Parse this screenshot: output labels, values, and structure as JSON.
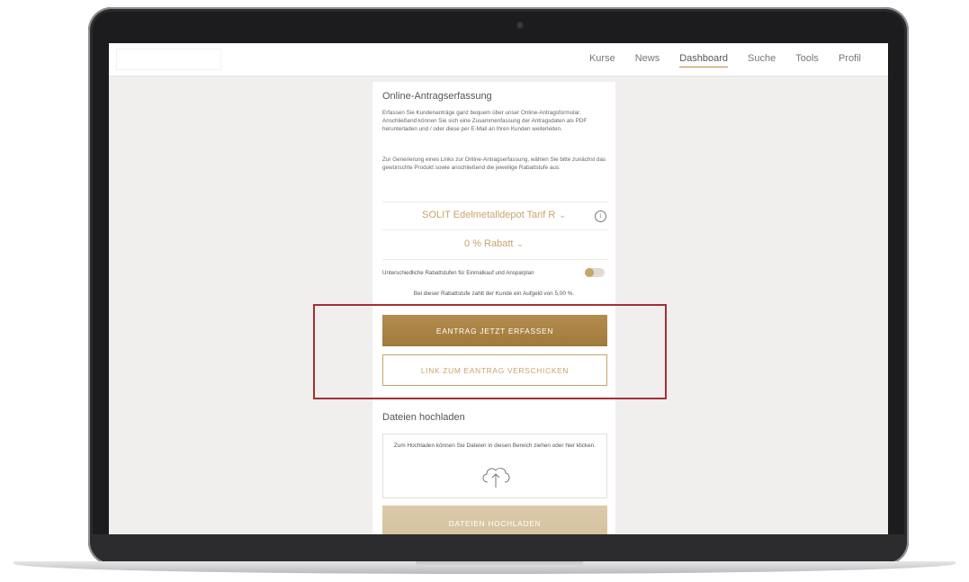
{
  "nav": {
    "items": [
      "Kurse",
      "News",
      "Dashboard",
      "Suche",
      "Tools",
      "Profil"
    ],
    "active": "Dashboard"
  },
  "card": {
    "title": "Online-Antragserfassung",
    "paragraph1": "Erfassen Sie Kundenanträge ganz bequem über unser Online-Antragsformular. Anschließend können Sie sich eine Zusammenfassung der Antragsdaten als PDF herunterladen und / oder diese per E-Mail an Ihren Kunden weiterleiten.",
    "paragraph2": "Zur Generierung eines Links zur Online-Antragserfassung, wählen Sie bitte zunächst das gewünschte Produkt sowie anschließend die jeweilige Rabattstufe aus:",
    "product": "SOLIT Edelmetalldepot Tarif R",
    "discount": "0 % Rabatt",
    "toggle_label": "Unterschiedliche Rabattstufen für Einmalkauf und Ansparplan",
    "aufgeld_note": "Bei dieser Rabattstufe zahlt der Kunde ein Aufgeld von 5,00 %.",
    "primary_button": "EANTRAG JETZT ERFASSEN",
    "secondary_button": "LINK ZUM EANTRAG VERSCHICKEN"
  },
  "upload": {
    "title": "Dateien hochladen",
    "dropzone_text": "Zum Hochladen können Sie Dateien in diesen Bereich ziehen oder hier klicken.",
    "button": "DATEIEN HOCHLADEN"
  },
  "colors": {
    "gold": "#c8a46a",
    "button_gold": "#a9834a",
    "highlight": "#a32f36"
  }
}
